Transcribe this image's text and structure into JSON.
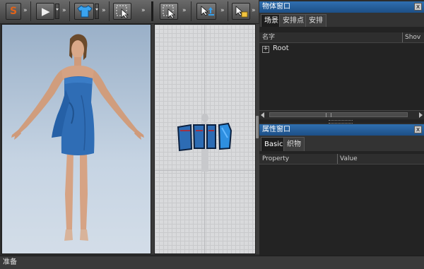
{
  "toolbar": {
    "chevron": "»",
    "tools": [
      {
        "name": "logo-button",
        "glyph": "S"
      },
      {
        "name": "play-button",
        "glyph": "▶"
      },
      {
        "name": "garment-button",
        "glyph": "shirt-icon"
      },
      {
        "name": "select-tool-3d",
        "glyph": "cursor-icon"
      },
      {
        "name": "select-tool-2d",
        "glyph": "cursor-icon"
      },
      {
        "name": "transform-tool-2d",
        "glyph": "cursor-move-icon"
      },
      {
        "name": "edit-tool-2d",
        "glyph": "cursor-edit-icon"
      }
    ]
  },
  "object_window": {
    "title": "物体窗口",
    "close": "x",
    "tabs": [
      "场景",
      "安排点",
      "安排"
    ],
    "active_tab": 0,
    "columns": [
      "名字",
      "Shov"
    ],
    "tree": [
      {
        "expander": "+",
        "label": "Root"
      }
    ]
  },
  "property_window": {
    "title": "属性窗口",
    "close": "x",
    "tabs": [
      "Basic",
      "织物"
    ],
    "active_tab": 0,
    "columns": [
      "Property",
      "Value"
    ]
  },
  "status": {
    "text": "准备"
  },
  "colors": {
    "accent": "#2a68a8",
    "dress": "#2f6db5",
    "viewport_3d_top": "#9ab0c8",
    "viewport_2d": "#d9dadc"
  }
}
